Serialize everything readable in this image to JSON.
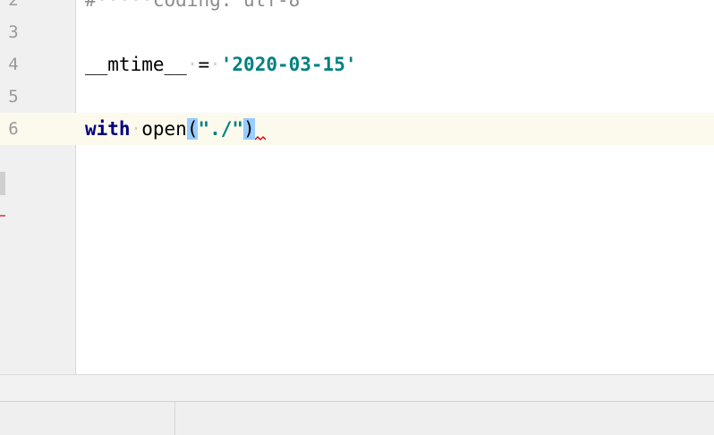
{
  "editor": {
    "lines": [
      {
        "number": "2",
        "comment_hash": "#",
        "comment_text": "coding: utf-8"
      },
      {
        "number": "3"
      },
      {
        "number": "4",
        "var_name": "__mtime__",
        "operator": "=",
        "string_value": "'2020-03-15'"
      },
      {
        "number": "5"
      },
      {
        "number": "6",
        "keyword": "with",
        "func_name": "open",
        "paren_open": "(",
        "string_arg": "\"./\"",
        "paren_close": ")"
      }
    ],
    "current_line": "6"
  },
  "colors": {
    "keyword": "#000080",
    "string": "#008080",
    "current_line_bg": "#fcfaed",
    "brace_match": "#99ccff",
    "error_underline": "#e00000"
  },
  "icons": [
    "error-squiggle-icon"
  ]
}
